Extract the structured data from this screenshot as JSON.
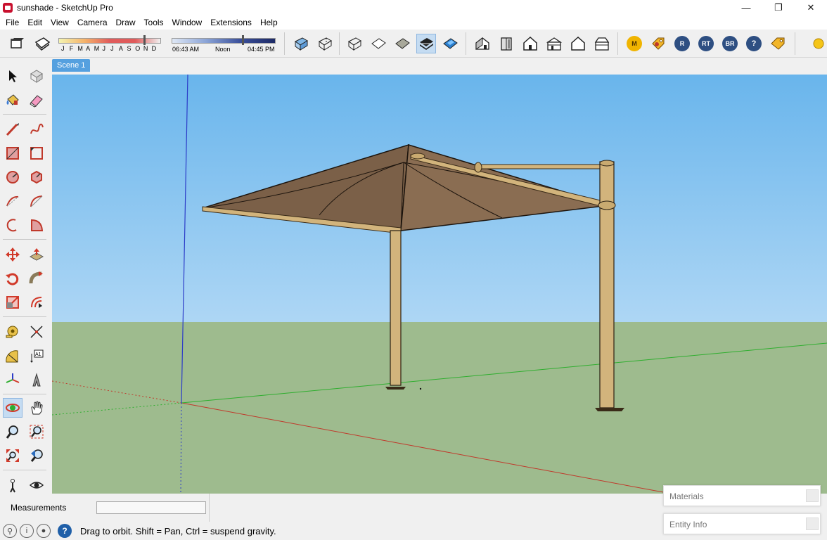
{
  "window": {
    "title": "sunshade - SketchUp Pro",
    "minimize_glyph": "—",
    "restore_glyph": "❐",
    "close_glyph": "✕"
  },
  "menu": [
    "File",
    "Edit",
    "View",
    "Camera",
    "Draw",
    "Tools",
    "Window",
    "Extensions",
    "Help"
  ],
  "shadows": {
    "months": [
      "J",
      "F",
      "M",
      "A",
      "M",
      "J",
      "J",
      "A",
      "S",
      "O",
      "N",
      "D"
    ],
    "time_start": "06:43 AM",
    "time_mid": "Noon",
    "time_end": "04:45 PM"
  },
  "extension_buttons": [
    "M",
    "R",
    "RT",
    "BR",
    "?"
  ],
  "scene": {
    "tab": "Scene 1"
  },
  "measurements": {
    "label": "Measurements",
    "value": ""
  },
  "status": {
    "text": "Drag to orbit. Shift = Pan, Ctrl = suspend gravity."
  },
  "tray": {
    "materials": "Materials",
    "entity_info": "Entity Info"
  },
  "colors": {
    "accent": "#55a0df",
    "sky": "#69b5ec",
    "ground": "#9ebb8e",
    "canopy": "#7b6048",
    "post": "#d2b47c",
    "axis_red": "#c0392b",
    "axis_green": "#2fae2f",
    "axis_blue": "#2c3cc8"
  }
}
